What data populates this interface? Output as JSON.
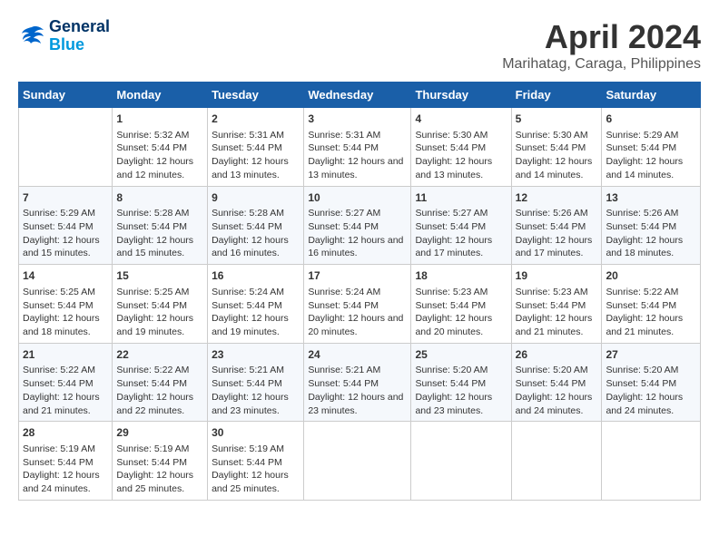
{
  "header": {
    "logo_line1": "General",
    "logo_line2": "Blue",
    "month": "April 2024",
    "location": "Marihatag, Caraga, Philippines"
  },
  "days_of_week": [
    "Sunday",
    "Monday",
    "Tuesday",
    "Wednesday",
    "Thursday",
    "Friday",
    "Saturday"
  ],
  "weeks": [
    [
      {
        "day": "",
        "content": ""
      },
      {
        "day": "1",
        "sunrise": "5:32 AM",
        "sunset": "5:44 PM",
        "daylight": "12 hours and 12 minutes."
      },
      {
        "day": "2",
        "sunrise": "5:31 AM",
        "sunset": "5:44 PM",
        "daylight": "12 hours and 13 minutes."
      },
      {
        "day": "3",
        "sunrise": "5:31 AM",
        "sunset": "5:44 PM",
        "daylight": "12 hours and 13 minutes."
      },
      {
        "day": "4",
        "sunrise": "5:30 AM",
        "sunset": "5:44 PM",
        "daylight": "12 hours and 13 minutes."
      },
      {
        "day": "5",
        "sunrise": "5:30 AM",
        "sunset": "5:44 PM",
        "daylight": "12 hours and 14 minutes."
      },
      {
        "day": "6",
        "sunrise": "5:29 AM",
        "sunset": "5:44 PM",
        "daylight": "12 hours and 14 minutes."
      }
    ],
    [
      {
        "day": "7",
        "sunrise": "5:29 AM",
        "sunset": "5:44 PM",
        "daylight": "12 hours and 15 minutes."
      },
      {
        "day": "8",
        "sunrise": "5:28 AM",
        "sunset": "5:44 PM",
        "daylight": "12 hours and 15 minutes."
      },
      {
        "day": "9",
        "sunrise": "5:28 AM",
        "sunset": "5:44 PM",
        "daylight": "12 hours and 16 minutes."
      },
      {
        "day": "10",
        "sunrise": "5:27 AM",
        "sunset": "5:44 PM",
        "daylight": "12 hours and 16 minutes."
      },
      {
        "day": "11",
        "sunrise": "5:27 AM",
        "sunset": "5:44 PM",
        "daylight": "12 hours and 17 minutes."
      },
      {
        "day": "12",
        "sunrise": "5:26 AM",
        "sunset": "5:44 PM",
        "daylight": "12 hours and 17 minutes."
      },
      {
        "day": "13",
        "sunrise": "5:26 AM",
        "sunset": "5:44 PM",
        "daylight": "12 hours and 18 minutes."
      }
    ],
    [
      {
        "day": "14",
        "sunrise": "5:25 AM",
        "sunset": "5:44 PM",
        "daylight": "12 hours and 18 minutes."
      },
      {
        "day": "15",
        "sunrise": "5:25 AM",
        "sunset": "5:44 PM",
        "daylight": "12 hours and 19 minutes."
      },
      {
        "day": "16",
        "sunrise": "5:24 AM",
        "sunset": "5:44 PM",
        "daylight": "12 hours and 19 minutes."
      },
      {
        "day": "17",
        "sunrise": "5:24 AM",
        "sunset": "5:44 PM",
        "daylight": "12 hours and 20 minutes."
      },
      {
        "day": "18",
        "sunrise": "5:23 AM",
        "sunset": "5:44 PM",
        "daylight": "12 hours and 20 minutes."
      },
      {
        "day": "19",
        "sunrise": "5:23 AM",
        "sunset": "5:44 PM",
        "daylight": "12 hours and 21 minutes."
      },
      {
        "day": "20",
        "sunrise": "5:22 AM",
        "sunset": "5:44 PM",
        "daylight": "12 hours and 21 minutes."
      }
    ],
    [
      {
        "day": "21",
        "sunrise": "5:22 AM",
        "sunset": "5:44 PM",
        "daylight": "12 hours and 21 minutes."
      },
      {
        "day": "22",
        "sunrise": "5:22 AM",
        "sunset": "5:44 PM",
        "daylight": "12 hours and 22 minutes."
      },
      {
        "day": "23",
        "sunrise": "5:21 AM",
        "sunset": "5:44 PM",
        "daylight": "12 hours and 23 minutes."
      },
      {
        "day": "24",
        "sunrise": "5:21 AM",
        "sunset": "5:44 PM",
        "daylight": "12 hours and 23 minutes."
      },
      {
        "day": "25",
        "sunrise": "5:20 AM",
        "sunset": "5:44 PM",
        "daylight": "12 hours and 23 minutes."
      },
      {
        "day": "26",
        "sunrise": "5:20 AM",
        "sunset": "5:44 PM",
        "daylight": "12 hours and 24 minutes."
      },
      {
        "day": "27",
        "sunrise": "5:20 AM",
        "sunset": "5:44 PM",
        "daylight": "12 hours and 24 minutes."
      }
    ],
    [
      {
        "day": "28",
        "sunrise": "5:19 AM",
        "sunset": "5:44 PM",
        "daylight": "12 hours and 24 minutes."
      },
      {
        "day": "29",
        "sunrise": "5:19 AM",
        "sunset": "5:44 PM",
        "daylight": "12 hours and 25 minutes."
      },
      {
        "day": "30",
        "sunrise": "5:19 AM",
        "sunset": "5:44 PM",
        "daylight": "12 hours and 25 minutes."
      },
      {
        "day": "",
        "content": ""
      },
      {
        "day": "",
        "content": ""
      },
      {
        "day": "",
        "content": ""
      },
      {
        "day": "",
        "content": ""
      }
    ]
  ],
  "labels": {
    "sunrise": "Sunrise:",
    "sunset": "Sunset:",
    "daylight": "Daylight:"
  }
}
